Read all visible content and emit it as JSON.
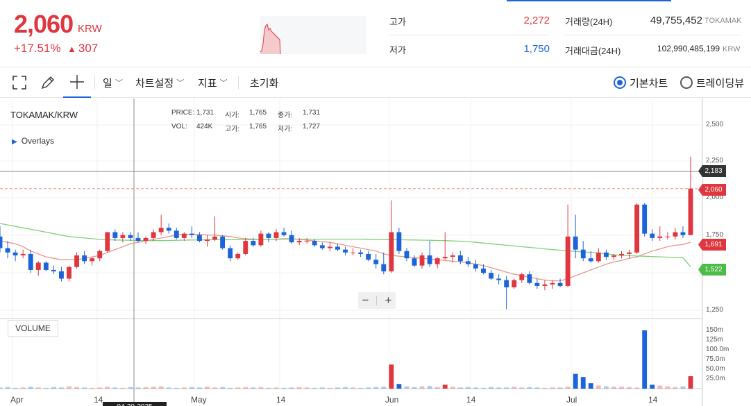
{
  "header": {
    "price": "2,060",
    "unit": "KRW",
    "change_pct": "+17.51%",
    "change_arrow": "▲",
    "change_abs": "307",
    "high_label": "고가",
    "high_value": "2,272",
    "low_label": "저가",
    "low_value": "1,750",
    "volume_label": "거래량(24H)",
    "volume_value": "49,755,452",
    "volume_unit": "TOKAMAK",
    "amount_label": "거래대금(24H)",
    "amount_value": "102,990,485,199",
    "amount_unit": "KRW"
  },
  "toolbar": {
    "period": "일",
    "chart_settings": "차트설정",
    "indicators": "지표",
    "reset": "초기화",
    "basic_chart": "기본차트",
    "trading_view": "트레이딩뷰"
  },
  "legend": {
    "title": "TOKAMAK/KRW",
    "overlays": "Overlays",
    "price_lbl": "PRICE:",
    "price_val": "1,731",
    "open_lbl": "시가:",
    "open_val": "1,765",
    "close_lbl": "종가:",
    "close_val": "1,731",
    "vol_lbl": "VOL:",
    "vol_val": "424K",
    "high_lbl": "고가:",
    "high_val": "1,765",
    "low_lbl": "저가:",
    "low_val": "1,727",
    "volume_panel": "VOLUME"
  },
  "axis": {
    "y_ticks": [
      "2,500",
      "2,250",
      "2,000",
      "1,750",
      "1,250"
    ],
    "vol_ticks": [
      "150m",
      "125m",
      "100.0m",
      "75.0m",
      "50.0m",
      "25.0m"
    ],
    "x_ticks": [
      "Apr",
      "14",
      "May",
      "14",
      "Jun",
      "14",
      "Jul",
      "14"
    ],
    "crosshair_date": "04-30-2025",
    "tag_cursor": "2,183",
    "tag_price": "2,060",
    "tag_ma1": "1,691",
    "tag_ma2": "1,522"
  },
  "colors": {
    "up": "#e0363f",
    "down": "#1b64da",
    "ma_short": "#e8968c",
    "ma_long": "#7fd07a"
  },
  "chart_data": {
    "type": "candlestick",
    "title": "TOKAMAK/KRW",
    "series": [
      {
        "name": "price",
        "values": [
          [
            1730,
            1800,
            1620,
            1650
          ],
          [
            1650,
            1700,
            1580,
            1620
          ],
          [
            1620,
            1640,
            1560,
            1600
          ],
          [
            1600,
            1640,
            1580,
            1610
          ],
          [
            1610,
            1640,
            1480,
            1500
          ],
          [
            1500,
            1560,
            1460,
            1550
          ],
          [
            1550,
            1560,
            1490,
            1500
          ],
          [
            1500,
            1530,
            1470,
            1490
          ],
          [
            1490,
            1520,
            1420,
            1440
          ],
          [
            1440,
            1530,
            1420,
            1520
          ],
          [
            1520,
            1620,
            1510,
            1600
          ],
          [
            1600,
            1630,
            1540,
            1560
          ],
          [
            1560,
            1590,
            1530,
            1580
          ],
          [
            1580,
            1640,
            1560,
            1630
          ],
          [
            1630,
            1760,
            1620,
            1760
          ],
          [
            1760,
            1780,
            1700,
            1720
          ],
          [
            1720,
            1760,
            1690,
            1740
          ],
          [
            1740,
            1760,
            1700,
            1720
          ],
          [
            1720,
            1760,
            1690,
            1700
          ],
          [
            1700,
            1730,
            1680,
            1720
          ],
          [
            1720,
            1780,
            1700,
            1760
          ],
          [
            1760,
            1880,
            1740,
            1790
          ],
          [
            1790,
            1820,
            1750,
            1770
          ],
          [
            1770,
            1790,
            1710,
            1720
          ],
          [
            1720,
            1760,
            1700,
            1750
          ],
          [
            1750,
            1800,
            1720,
            1740
          ],
          [
            1740,
            1760,
            1690,
            1700
          ],
          [
            1700,
            1740,
            1660,
            1710
          ],
          [
            1710,
            1870,
            1700,
            1730
          ],
          [
            1730,
            1740,
            1640,
            1650
          ],
          [
            1650,
            1670,
            1560,
            1580
          ],
          [
            1580,
            1620,
            1570,
            1610
          ],
          [
            1610,
            1720,
            1600,
            1700
          ],
          [
            1700,
            1720,
            1660,
            1670
          ],
          [
            1670,
            1770,
            1660,
            1750
          ],
          [
            1750,
            1760,
            1690,
            1720
          ],
          [
            1720,
            1780,
            1700,
            1760
          ],
          [
            1760,
            1790,
            1730,
            1740
          ],
          [
            1740,
            1770,
            1680,
            1690
          ],
          [
            1690,
            1720,
            1670,
            1700
          ],
          [
            1700,
            1720,
            1680,
            1700
          ],
          [
            1700,
            1710,
            1660,
            1670
          ],
          [
            1670,
            1690,
            1640,
            1650
          ],
          [
            1650,
            1690,
            1630,
            1660
          ],
          [
            1660,
            1680,
            1630,
            1640
          ],
          [
            1640,
            1660,
            1600,
            1620
          ],
          [
            1620,
            1650,
            1600,
            1620
          ],
          [
            1620,
            1640,
            1590,
            1610
          ],
          [
            1610,
            1630,
            1560,
            1570
          ],
          [
            1570,
            1610,
            1510,
            1540
          ],
          [
            1540,
            1620,
            1470,
            1490
          ],
          [
            1490,
            1980,
            1480,
            1760
          ],
          [
            1760,
            1790,
            1610,
            1630
          ],
          [
            1630,
            1650,
            1560,
            1580
          ],
          [
            1580,
            1600,
            1520,
            1530
          ],
          [
            1530,
            1620,
            1510,
            1600
          ],
          [
            1600,
            1700,
            1520,
            1540
          ],
          [
            1540,
            1590,
            1510,
            1580
          ],
          [
            1580,
            1760,
            1570,
            1590
          ],
          [
            1590,
            1620,
            1550,
            1600
          ],
          [
            1600,
            1630,
            1540,
            1560
          ],
          [
            1560,
            1590,
            1520,
            1540
          ],
          [
            1540,
            1570,
            1490,
            1510
          ],
          [
            1510,
            1540,
            1470,
            1480
          ],
          [
            1480,
            1500,
            1430,
            1440
          ],
          [
            1440,
            1470,
            1400,
            1430
          ],
          [
            1430,
            1460,
            1230,
            1380
          ],
          [
            1380,
            1440,
            1370,
            1430
          ],
          [
            1430,
            1480,
            1410,
            1470
          ],
          [
            1470,
            1490,
            1400,
            1410
          ],
          [
            1410,
            1440,
            1370,
            1390
          ],
          [
            1390,
            1430,
            1360,
            1400
          ],
          [
            1400,
            1430,
            1370,
            1410
          ],
          [
            1410,
            1440,
            1380,
            1390
          ],
          [
            1390,
            1950,
            1380,
            1730
          ],
          [
            1730,
            1880,
            1580,
            1640
          ],
          [
            1640,
            1700,
            1560,
            1580
          ],
          [
            1580,
            1630,
            1550,
            1560
          ],
          [
            1560,
            1650,
            1550,
            1620
          ],
          [
            1620,
            1640,
            1570,
            1590
          ],
          [
            1590,
            1610,
            1570,
            1600
          ],
          [
            1600,
            1630,
            1580,
            1610
          ],
          [
            1610,
            1640,
            1580,
            1620
          ],
          [
            1620,
            1960,
            1610,
            1950
          ],
          [
            1950,
            1960,
            1730,
            1750
          ],
          [
            1750,
            1780,
            1700,
            1720
          ],
          [
            1720,
            1800,
            1700,
            1730
          ],
          [
            1730,
            1760,
            1710,
            1730
          ],
          [
            1730,
            1790,
            1710,
            1760
          ],
          [
            1760,
            1800,
            1720,
            1740
          ],
          [
            1740,
            2280,
            1740,
            2060
          ]
        ]
      },
      {
        "name": "volume",
        "values": [
          3,
          4,
          2,
          3,
          5,
          3,
          2,
          4,
          3,
          6,
          4,
          3,
          2,
          3,
          5,
          3,
          2,
          4,
          3,
          4,
          5,
          6,
          3,
          2,
          3,
          4,
          3,
          5,
          3,
          4,
          2,
          3,
          4,
          3,
          4,
          2,
          3,
          2,
          3,
          4,
          3,
          2,
          3,
          2,
          3,
          4,
          3,
          2,
          3,
          4,
          5,
          62,
          12,
          6,
          4,
          6,
          7,
          4,
          10,
          5,
          3,
          4,
          3,
          2,
          4,
          3,
          3,
          5,
          3,
          4,
          3,
          2,
          3,
          3,
          5,
          38,
          30,
          14,
          8,
          6,
          5,
          5,
          4,
          3,
          150,
          10,
          8,
          6,
          4,
          6,
          32
        ]
      },
      {
        "name": "ma_short",
        "values": [
          1700,
          1690,
          1680,
          1660,
          1630,
          1610,
          1590,
          1580,
          1570,
          1570,
          1570,
          1580,
          1590,
          1600,
          1620,
          1640,
          1660,
          1680,
          1690,
          1700,
          1710,
          1720,
          1730,
          1740,
          1745,
          1745,
          1745,
          1740,
          1740,
          1735,
          1730,
          1720,
          1715,
          1712,
          1710,
          1710,
          1712,
          1715,
          1715,
          1710,
          1705,
          1700,
          1695,
          1690,
          1680,
          1670,
          1660,
          1650,
          1640,
          1630,
          1610,
          1600,
          1595,
          1590,
          1585,
          1580,
          1575,
          1570,
          1565,
          1560,
          1555,
          1550,
          1540,
          1530,
          1515,
          1500,
          1485,
          1470,
          1460,
          1450,
          1440,
          1430,
          1425,
          1425,
          1440,
          1460,
          1480,
          1500,
          1520,
          1540,
          1555,
          1565,
          1580,
          1590,
          1610,
          1630,
          1645,
          1660,
          1670,
          1675,
          1691
        ]
      },
      {
        "name": "ma_long",
        "values": [
          1820,
          1810,
          1800,
          1790,
          1780,
          1770,
          1760,
          1750,
          1740,
          1730,
          1725,
          1720,
          1715,
          1710,
          1708,
          1706,
          1705,
          1704,
          1703,
          1702,
          1702,
          1702,
          1703,
          1704,
          1705,
          1706,
          1707,
          1707,
          1708,
          1708,
          1708,
          1708,
          1708,
          1709,
          1710,
          1710,
          1711,
          1712,
          1712,
          1712,
          1712,
          1712,
          1712,
          1712,
          1712,
          1712,
          1712,
          1712,
          1711,
          1710,
          1709,
          1708,
          1708,
          1707,
          1706,
          1705,
          1704,
          1703,
          1702,
          1700,
          1698,
          1695,
          1690,
          1685,
          1680,
          1675,
          1670,
          1665,
          1660,
          1655,
          1650,
          1645,
          1640,
          1636,
          1632,
          1628,
          1624,
          1620,
          1615,
          1610,
          1605,
          1600,
          1598,
          1596,
          1594,
          1592,
          1590,
          1588,
          1586,
          1584,
          1522
        ]
      }
    ],
    "y_range": [
      1170,
      2680
    ],
    "volume_range": [
      0,
      175
    ],
    "x_labels": [
      "Apr",
      "14",
      "May",
      "14",
      "Jun",
      "14",
      "Jul",
      "14"
    ]
  }
}
